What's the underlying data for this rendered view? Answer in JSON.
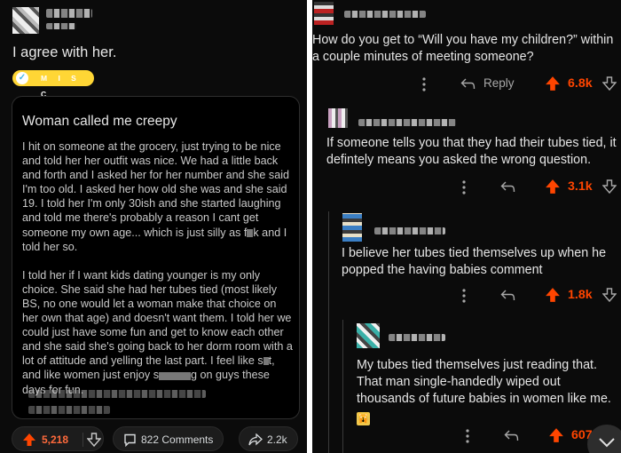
{
  "left_post": {
    "title": "I agree with her.",
    "flair": "M I S C",
    "card_title": "Woman called me creepy",
    "para1": "I hit on someone at the grocery, just trying to be nice and told her her outfit was nice. We had a little back and forth and I asked her for her number and she said I'm too old. I asked her how old she was and she said 19. I told her I'm only 30ish and she started laughing and told me there's probably a reason I cant get someone my own age... which is just silly as f",
    "para1_end": "k and I told her so.",
    "para2a": "I told her if I want kids dating younger is my only choice. She said she had her tubes tied (most likely BS, no one would let a woman make that choice on her own that age) and doesn't want them. I told her we could just have some fun and get to know each other and she said she's going back to her dorm room with a lot of attitude and yelling the last part. I feel like s",
    "para2b": "t, and like women just enjoy s",
    "para2c": "g on guys these days for fun.",
    "vote_count": "5,218",
    "comments_label": "822 Comments",
    "share_count": "2.2k"
  },
  "right_thread": {
    "question": "How do you get to “Will you have my children?” within a couple minutes of meeting someone?",
    "reply_label": "Reply",
    "score1": "6.8k",
    "comment1": "If someone tells you that they had their tubes tied, it defintely means you asked the wrong question.",
    "score2": "3.1k",
    "comment2": "I believe her tubes tied themselves up when he popped the having babies comment",
    "score3": "1.8k",
    "comment3": "My tubes tied themselves just reading that. That man single-handedly wiped out thousands of future babies in women like me.",
    "emoji": "🙀",
    "score4": "607"
  },
  "colors": {
    "upvote": "#ff4500",
    "background": "#0b0b0b",
    "flair": "#ffd635"
  }
}
